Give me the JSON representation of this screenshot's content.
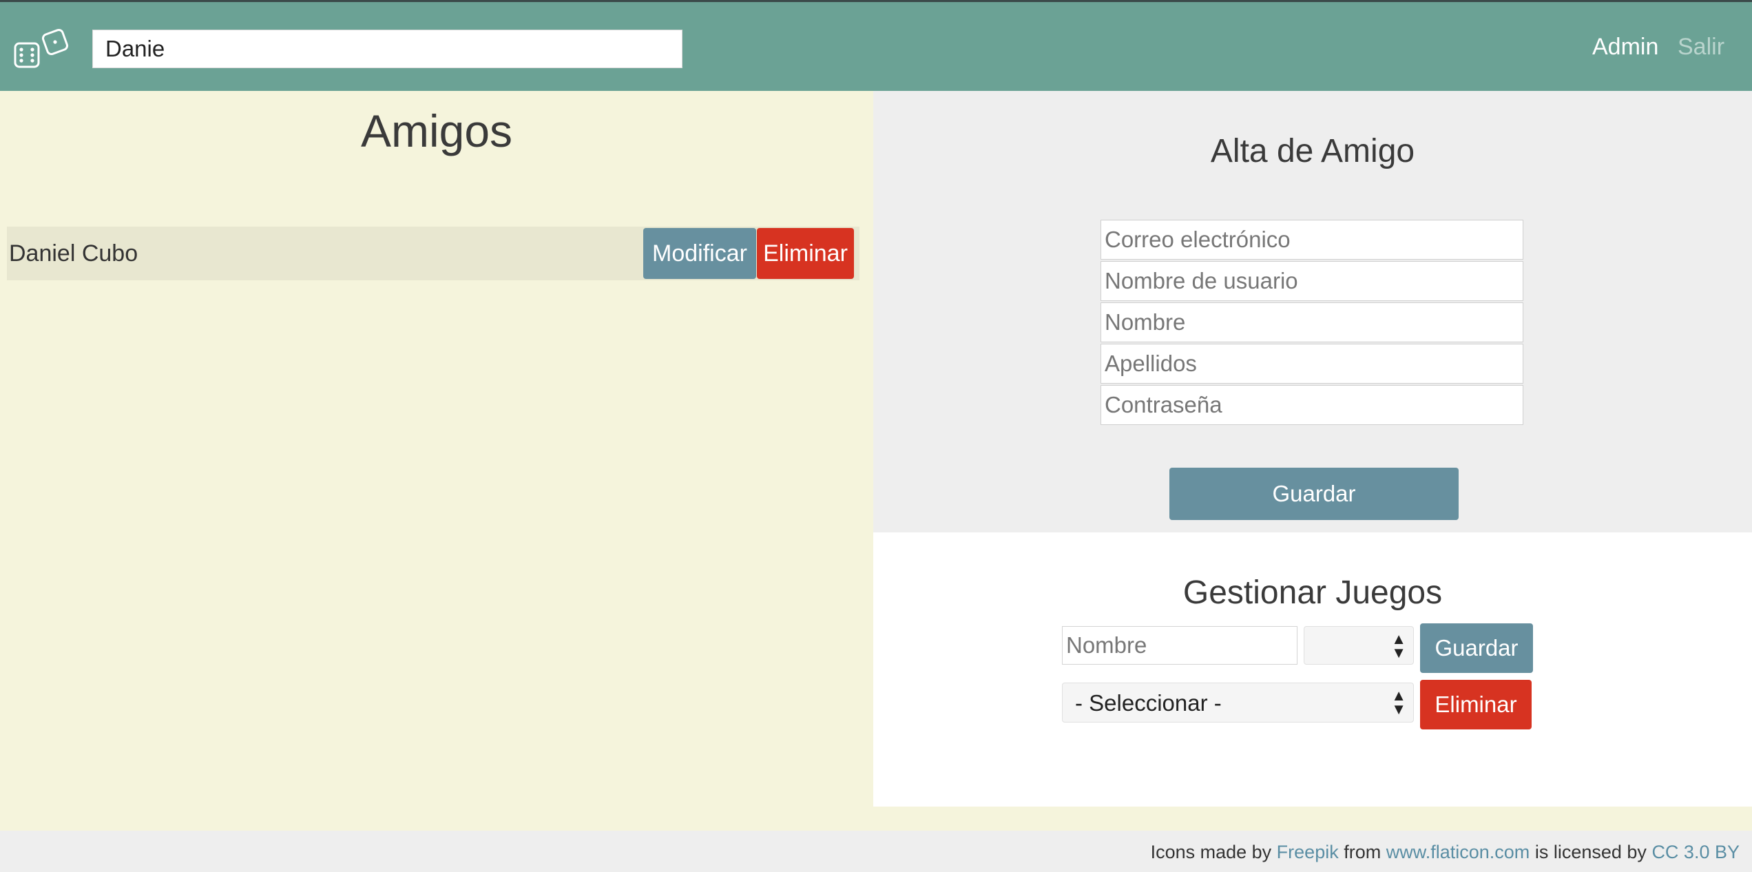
{
  "header": {
    "logo_icon": "dice-icon",
    "search_value": "Danie",
    "nav": {
      "admin_label": "Admin",
      "logout_label": "Salir"
    }
  },
  "friends": {
    "title": "Amigos",
    "items": [
      {
        "name": "Daniel Cubo",
        "edit_label": "Modificar",
        "delete_label": "Eliminar"
      }
    ]
  },
  "add_friend": {
    "title": "Alta de Amigo",
    "fields": {
      "email_placeholder": "Correo electrónico",
      "username_placeholder": "Nombre de usuario",
      "name_placeholder": "Nombre",
      "lastname_placeholder": "Apellidos",
      "password_placeholder": "Contraseña"
    },
    "save_label": "Guardar"
  },
  "games": {
    "title": "Gestionar Juegos",
    "name_placeholder": "Nombre",
    "type_selected": "",
    "save_label": "Guardar",
    "game_selected": "- Seleccionar -",
    "delete_label": "Eliminar"
  },
  "footer": {
    "prefix": "Icons made by",
    "author": "Freepik",
    "from": "from",
    "site": "www.flaticon.com",
    "licensed": "is licensed by",
    "license": "CC 3.0 BY"
  },
  "colors": {
    "header_bg": "#6ba295",
    "left_bg": "#f5f4dc",
    "right_top_bg": "#eeeeee",
    "button_blue": "#67909f",
    "button_red": "#d73321",
    "link": "#5a8ea4"
  }
}
